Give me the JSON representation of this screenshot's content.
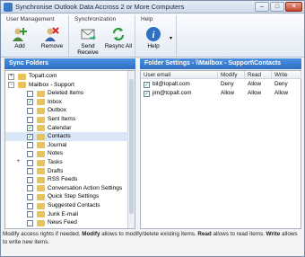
{
  "window": {
    "title": "Synchronise Outlook Data Accross 2 or More Computers",
    "min": "–",
    "max": "□",
    "close": "✕"
  },
  "ribbon": {
    "groups": [
      {
        "title": "User Management",
        "buttons": [
          {
            "label": "Add",
            "icon": "add-user-icon"
          },
          {
            "label": "Remove",
            "icon": "remove-user-icon"
          }
        ]
      },
      {
        "title": "Synchronization",
        "buttons": [
          {
            "label": "Send",
            "label2": "Receive",
            "icon": "send-receive-icon"
          },
          {
            "label": "Resync All",
            "icon": "resync-icon"
          }
        ]
      },
      {
        "title": "Help",
        "buttons": [
          {
            "label": "Help",
            "icon": "help-icon"
          }
        ]
      }
    ]
  },
  "sync_folders": {
    "header": "Sync Folders",
    "rows": [
      {
        "label": "Topalt.com",
        "level": 0,
        "expander": "+",
        "checkbox": false
      },
      {
        "label": "Mailbox - Support",
        "level": 0,
        "expander": "-",
        "checkbox": false
      },
      {
        "label": "Deleted Items",
        "level": 1,
        "checked": false
      },
      {
        "label": "Inbox",
        "level": 1,
        "checked": true
      },
      {
        "label": "Outbox",
        "level": 1,
        "checked": false
      },
      {
        "label": "Sent Items",
        "level": 1,
        "checked": false
      },
      {
        "label": "Calendar",
        "level": 1,
        "checked": true
      },
      {
        "label": "Contacts",
        "level": 1,
        "checked": true,
        "selected": true
      },
      {
        "label": "Journal",
        "level": 1,
        "checked": false
      },
      {
        "label": "Notes",
        "level": 1,
        "checked": false
      },
      {
        "label": "Tasks",
        "level": 1,
        "checked": false,
        "expander": "+"
      },
      {
        "label": "Drafts",
        "level": 1,
        "checked": false
      },
      {
        "label": "RSS Feeds",
        "level": 1,
        "checked": false
      },
      {
        "label": "Conversation Action Settings",
        "level": 1,
        "checked": false
      },
      {
        "label": "Quick Step Settings",
        "level": 1,
        "checked": false
      },
      {
        "label": "Suggested Contacts",
        "level": 1,
        "checked": false
      },
      {
        "label": "Junk E-mail",
        "level": 1,
        "checked": false
      },
      {
        "label": "News Feed",
        "level": 1,
        "checked": false
      }
    ]
  },
  "folder_settings": {
    "header": "Folder Settings - \\\\Mailbox - Support\\Contacts",
    "columns": [
      "User email",
      "Modify",
      "Read",
      "Write"
    ],
    "rows": [
      {
        "email": "bil@topalt.com",
        "checked": true,
        "modify": "Deny",
        "read": "Allow",
        "write": "Deny"
      },
      {
        "email": "jim@topalt.com",
        "checked": true,
        "modify": "Allow",
        "read": "Allow",
        "write": "Allow"
      }
    ]
  },
  "status": {
    "p1": "Modify access rights if needed. ",
    "b1": "Modify",
    "p2": " allows to modify/delete existing items. ",
    "b2": "Read",
    "p3": " allows to read items. ",
    "b3": "Write",
    "p4": " allows to write new items."
  },
  "colors": {
    "accent": "#2f6fc4",
    "folder": "#e8c25a"
  }
}
